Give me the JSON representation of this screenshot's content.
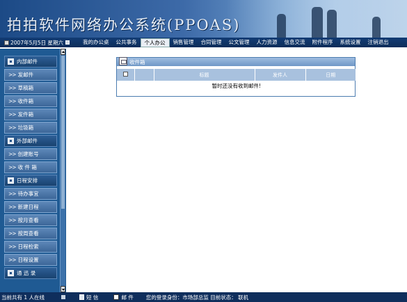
{
  "banner": {
    "title": "拍拍软件网络办公系统(PPOAS)"
  },
  "menubar": {
    "date": "2007年5月5日 星期六",
    "items": [
      "我的办公桌",
      "公共事务",
      "个人办公",
      "销售管理",
      "合同管理",
      "公文管理",
      "人力资源",
      "信息交流",
      "附件程序",
      "系统设置",
      "注销退出"
    ],
    "active": "个人办公"
  },
  "sidebar": {
    "sections": [
      {
        "title": "内部邮件",
        "items": [
          "发邮件",
          "草稿箱",
          "收件箱",
          "发件箱",
          "垃圾箱"
        ]
      },
      {
        "title": "外部邮件",
        "items": [
          "创建账号",
          "收 件 箱"
        ]
      },
      {
        "title": "日程安排",
        "items": [
          "待办事宜",
          "新建日程",
          "按月查看",
          "按周查看",
          "日程检索",
          "日程设置"
        ]
      },
      {
        "title": "通 迅 录",
        "items": []
      }
    ]
  },
  "inbox": {
    "title": "收件箱",
    "columns": [
      "标题",
      "发件人",
      "日期"
    ],
    "empty_message": "暂时还没有收到邮件!"
  },
  "status": {
    "online": "当前共有 1 人在线",
    "sms": "短 信",
    "mail": "邮 件",
    "login": "您的登录身份：市场部总监 目前状态： 联机"
  }
}
